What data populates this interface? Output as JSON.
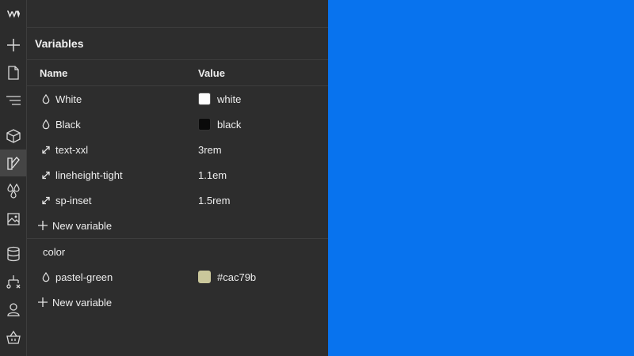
{
  "panel": {
    "title": "Variables",
    "columns": {
      "name": "Name",
      "value": "Value"
    }
  },
  "variables": [
    {
      "icon": "droplet-icon",
      "name": "White",
      "value": "white",
      "swatch": "#ffffff"
    },
    {
      "icon": "droplet-icon",
      "name": "Black",
      "value": "black",
      "swatch": "#0a0a0a"
    },
    {
      "icon": "resize-arrow-icon",
      "name": "text-xxl",
      "value": "3rem"
    },
    {
      "icon": "resize-arrow-icon",
      "name": "lineheight-tight",
      "value": "1.1em"
    },
    {
      "icon": "resize-arrow-icon",
      "name": "sp-inset",
      "value": "1.5rem"
    }
  ],
  "new_variable_label": "New variable",
  "group": {
    "name": "color",
    "variables": [
      {
        "icon": "droplet-icon",
        "name": "pastel-green",
        "value": "#cac79b",
        "swatch": "#cac79b"
      }
    ],
    "new_variable_label": "New variable"
  },
  "colors": {
    "canvas": "#0873ee",
    "panel": "#2d2d2d",
    "rail": "#2c2c2c"
  }
}
